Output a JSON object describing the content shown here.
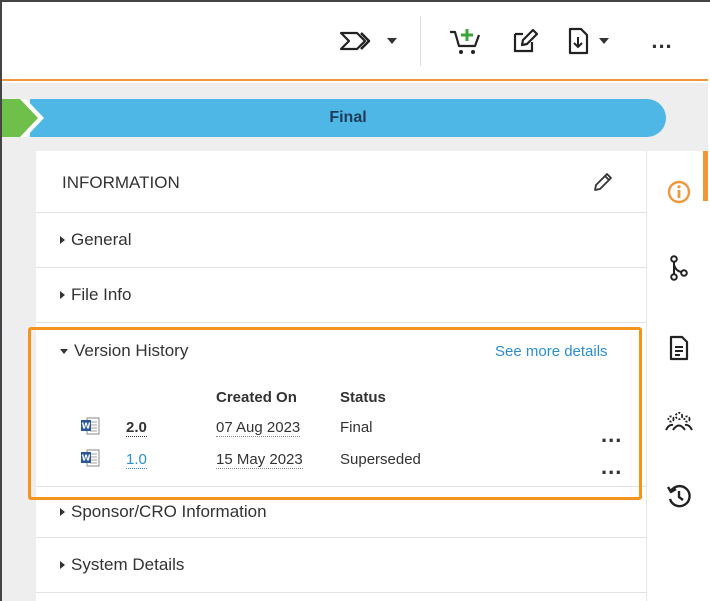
{
  "toolbar": {
    "workflow_icon": "workflow-arrows-icon",
    "add_to_cart_icon": "add-to-cart-icon",
    "edit_icon": "edit-icon",
    "download_icon": "download-icon",
    "more_icon": "more-icon",
    "more_label": "..."
  },
  "lifecycle": {
    "current_stage": "Final",
    "colors": {
      "previous": "#6fc04a",
      "current": "#4fb7e5"
    }
  },
  "panel": {
    "title": "INFORMATION",
    "sections": [
      {
        "label": "General",
        "expanded": false
      },
      {
        "label": "File Info",
        "expanded": false
      },
      {
        "label": "Version History",
        "expanded": true
      },
      {
        "label": "Sponsor/CRO Information",
        "expanded": false
      },
      {
        "label": "System Details",
        "expanded": false
      }
    ],
    "version_history": {
      "see_more": "See more details",
      "columns": [
        "Created On",
        "Status"
      ],
      "rows": [
        {
          "version": "2.0",
          "created_on": "07 Aug 2023",
          "status": "Final",
          "more": "..."
        },
        {
          "version": "1.0",
          "created_on": "15 May 2023",
          "status": "Superseded",
          "more": "..."
        }
      ]
    }
  },
  "right_rail": {
    "icons": [
      "info-icon",
      "relationships-icon",
      "document-icon",
      "people-icon",
      "history-icon"
    ],
    "accent_color": "#f0963b"
  },
  "highlight_color": "#f5941d"
}
